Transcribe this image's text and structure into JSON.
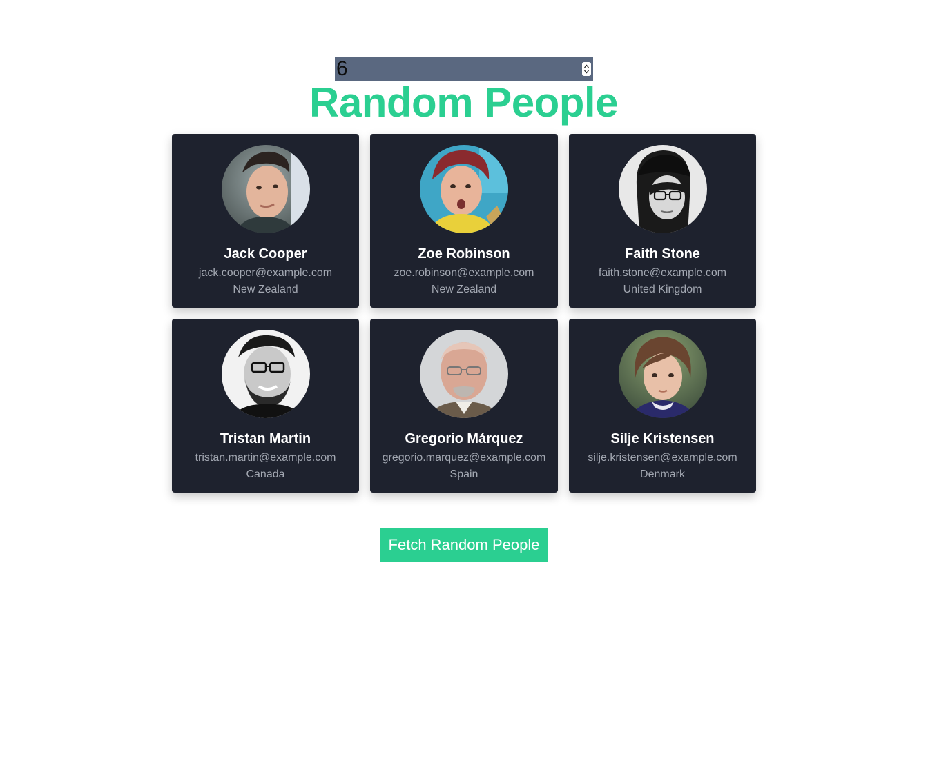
{
  "count_input": {
    "value": "6"
  },
  "title": "Random People",
  "people": [
    {
      "name": "Jack Cooper",
      "email": "jack.cooper@example.com",
      "country": "New Zealand",
      "avatar": "man-photo"
    },
    {
      "name": "Zoe Robinson",
      "email": "zoe.robinson@example.com",
      "country": "New Zealand",
      "avatar": "woman-photo"
    },
    {
      "name": "Faith Stone",
      "email": "faith.stone@example.com",
      "country": "United Kingdom",
      "avatar": "woman-photo"
    },
    {
      "name": "Tristan Martin",
      "email": "tristan.martin@example.com",
      "country": "Canada",
      "avatar": "man-photo"
    },
    {
      "name": "Gregorio Márquez",
      "email": "gregorio.marquez@example.com",
      "country": "Spain",
      "avatar": "man-photo"
    },
    {
      "name": "Silje Kristensen",
      "email": "silje.kristensen@example.com",
      "country": "Denmark",
      "avatar": "woman-photo"
    }
  ],
  "fetch_button_label": "Fetch Random People",
  "colors": {
    "accent": "#2bcf91",
    "card_bg": "#1e222e",
    "input_bg": "#5a6880",
    "muted_text": "#a3a8b2"
  }
}
